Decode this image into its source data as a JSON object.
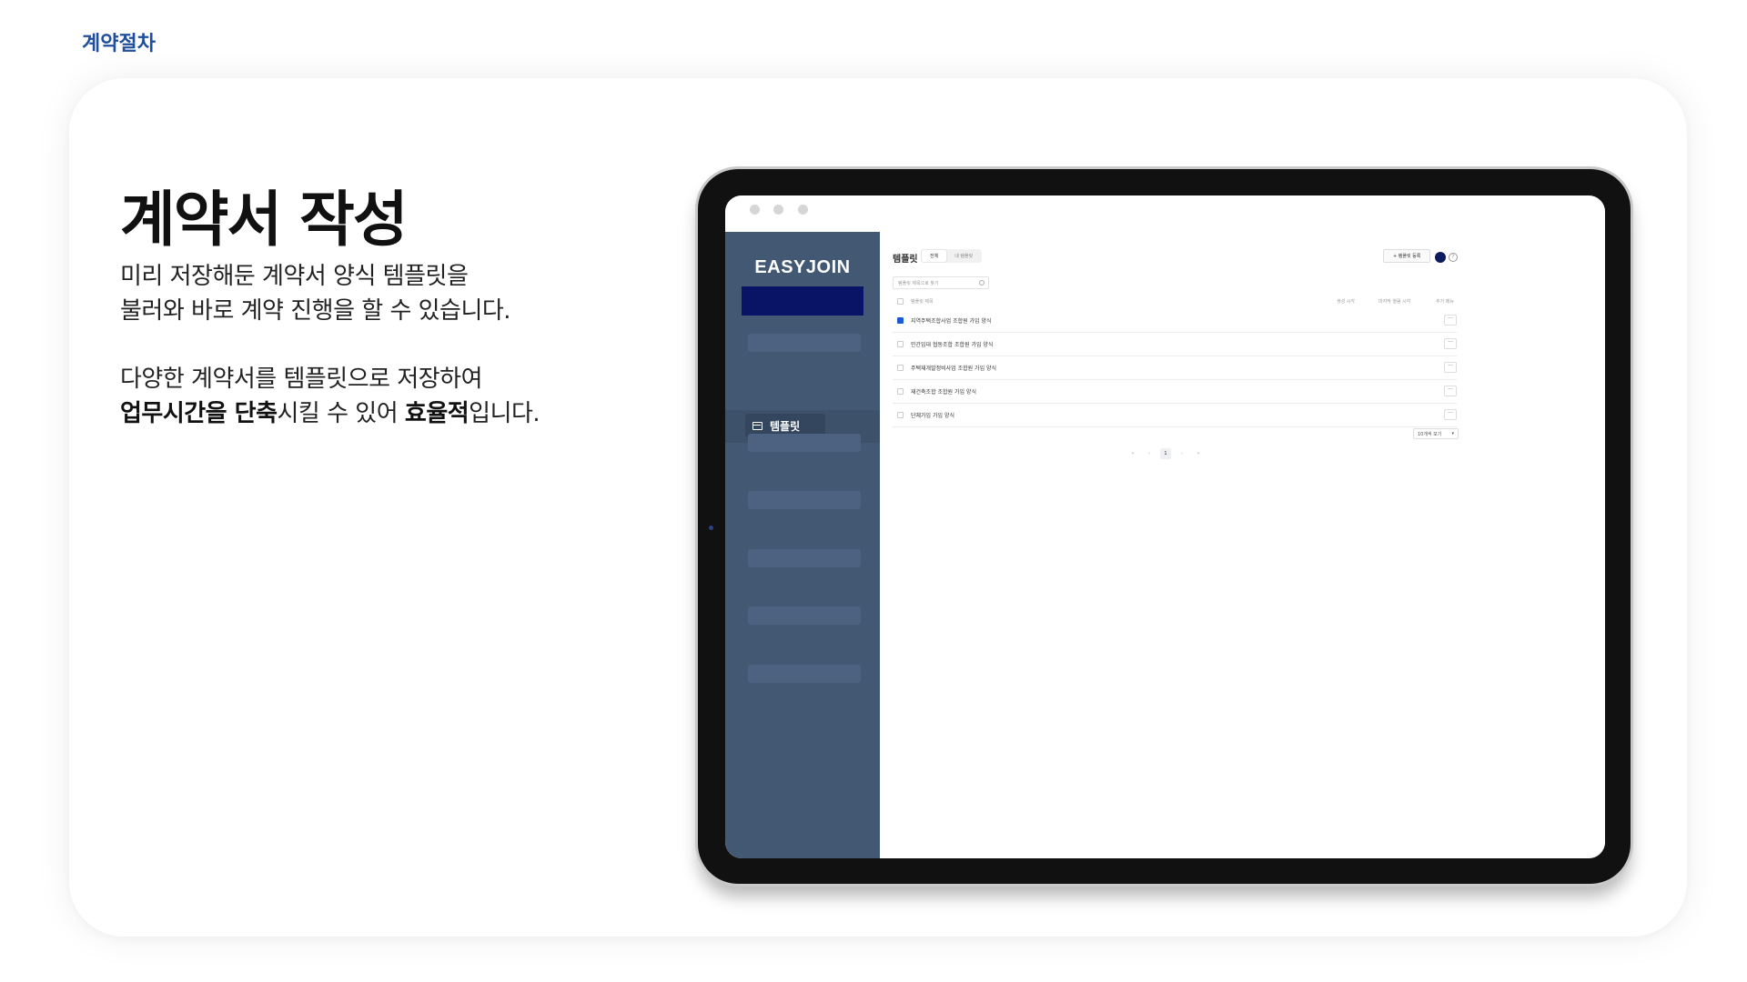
{
  "section_tag": "계약절차",
  "headline": "계약서 작성",
  "description1": {
    "line1": "미리 저장해둔 계약서 양식 템플릿을",
    "line2": "불러와 바로 계약 진행을 할 수 있습니다."
  },
  "description2": {
    "line1": "다양한 계약서를 템플릿으로 저장하여",
    "line2_bold1": "업무시간을 단축",
    "line2_text1": "시킬 수 있어 ",
    "line2_bold2": "효율적",
    "line2_text2": "입니다."
  },
  "app": {
    "brand": "EASYJOIN",
    "sidebar_active_label": "템플릿",
    "page_title": "템플릿",
    "tabs": [
      {
        "label": "전체",
        "active": true
      },
      {
        "label": "내 템플릿",
        "active": false
      }
    ],
    "add_button": "+ 템플릿 등록",
    "search_placeholder": "템플릿 제목으로 찾기",
    "table_headers": {
      "name": "템플릿 제목",
      "created": "생성 시각",
      "modified": "마지막 열람 시각",
      "more": "추가 메뉴"
    },
    "rows": [
      {
        "name": "지역주택조합사업 조합원 가입 양식",
        "checked": true
      },
      {
        "name": "민간임대 협동조합 조합원 가입 양식",
        "checked": false
      },
      {
        "name": "주택재개발정비사업 조합원 가입 양식",
        "checked": false
      },
      {
        "name": "재건축조합 조합원 가입 양식",
        "checked": false
      },
      {
        "name": "단체가입 가입 양식",
        "checked": false
      }
    ],
    "row_menu": "···",
    "per_page": "10개씩 보기",
    "pagination": {
      "first": "«",
      "prev": "‹",
      "current": "1",
      "next": "›",
      "last": "»"
    },
    "help_icon": "?"
  },
  "colors": {
    "accent_tag": "#1f4f9c",
    "sidebar": "#435873",
    "sidebar_cta": "#0a1467",
    "avatar": "#0e1a5e",
    "checkbox_checked": "#1a5ccf"
  }
}
